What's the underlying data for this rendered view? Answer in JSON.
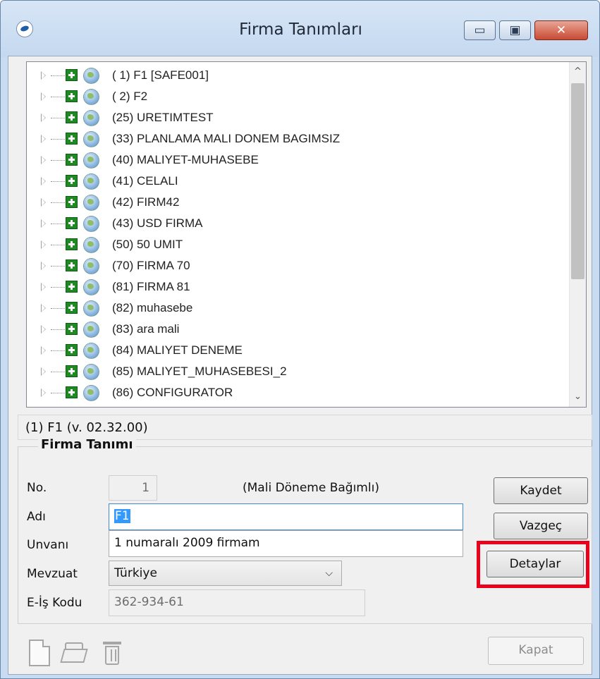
{
  "window": {
    "title": "Firma Tanımları",
    "controls": {
      "minimize": "▭",
      "maximize": "▣",
      "close": "✕"
    }
  },
  "tree": {
    "items": [
      {
        "label": "( 1) F1 [SAFE001]"
      },
      {
        "label": "( 2) F2"
      },
      {
        "label": "(25) URETIMTEST"
      },
      {
        "label": "(33) PLANLAMA MALI DONEM BAGIMSIZ"
      },
      {
        "label": "(40) MALIYET-MUHASEBE"
      },
      {
        "label": "(41) CELALI"
      },
      {
        "label": "(42) FIRM42"
      },
      {
        "label": "(43) USD FIRMA"
      },
      {
        "label": "(50) 50 UMIT"
      },
      {
        "label": "(70) FIRMA 70"
      },
      {
        "label": "(81) FIRMA 81"
      },
      {
        "label": "(82) muhasebe"
      },
      {
        "label": "(83) ara mali"
      },
      {
        "label": "(84) MALIYET DENEME"
      },
      {
        "label": "(85) MALIYET_MUHASEBESI_2"
      },
      {
        "label": "(86) CONFIGURATOR"
      }
    ],
    "scroll_up": "^",
    "scroll_down": "⌄"
  },
  "status": {
    "text": "(1) F1  (v. 02.32.00)"
  },
  "form": {
    "group_title": "Firma Tanımı",
    "no_label": "No.",
    "no_value": "1",
    "mali_note": "(Mali Döneme Bağımlı)",
    "adi_label": "Adı",
    "adi_value": "F1",
    "unvani_label": "Unvanı",
    "unvani_value": "1 numaralı 2009 firmam",
    "mevzuat_label": "Mevzuat",
    "mevzuat_value": "Türkiye",
    "eis_label": "E-İş Kodu",
    "eis_value": "362-934-61"
  },
  "buttons": {
    "kaydet": "Kaydet",
    "vazgec": "Vazgeç",
    "detaylar": "Detaylar",
    "kapat": "Kapat"
  },
  "toolbar_icons": [
    "new-document-icon",
    "open-folder-icon",
    "trash-icon"
  ],
  "colors": {
    "highlight": "#e8001c",
    "selection": "#3399ff",
    "tree_plus": "#1e8b22"
  }
}
